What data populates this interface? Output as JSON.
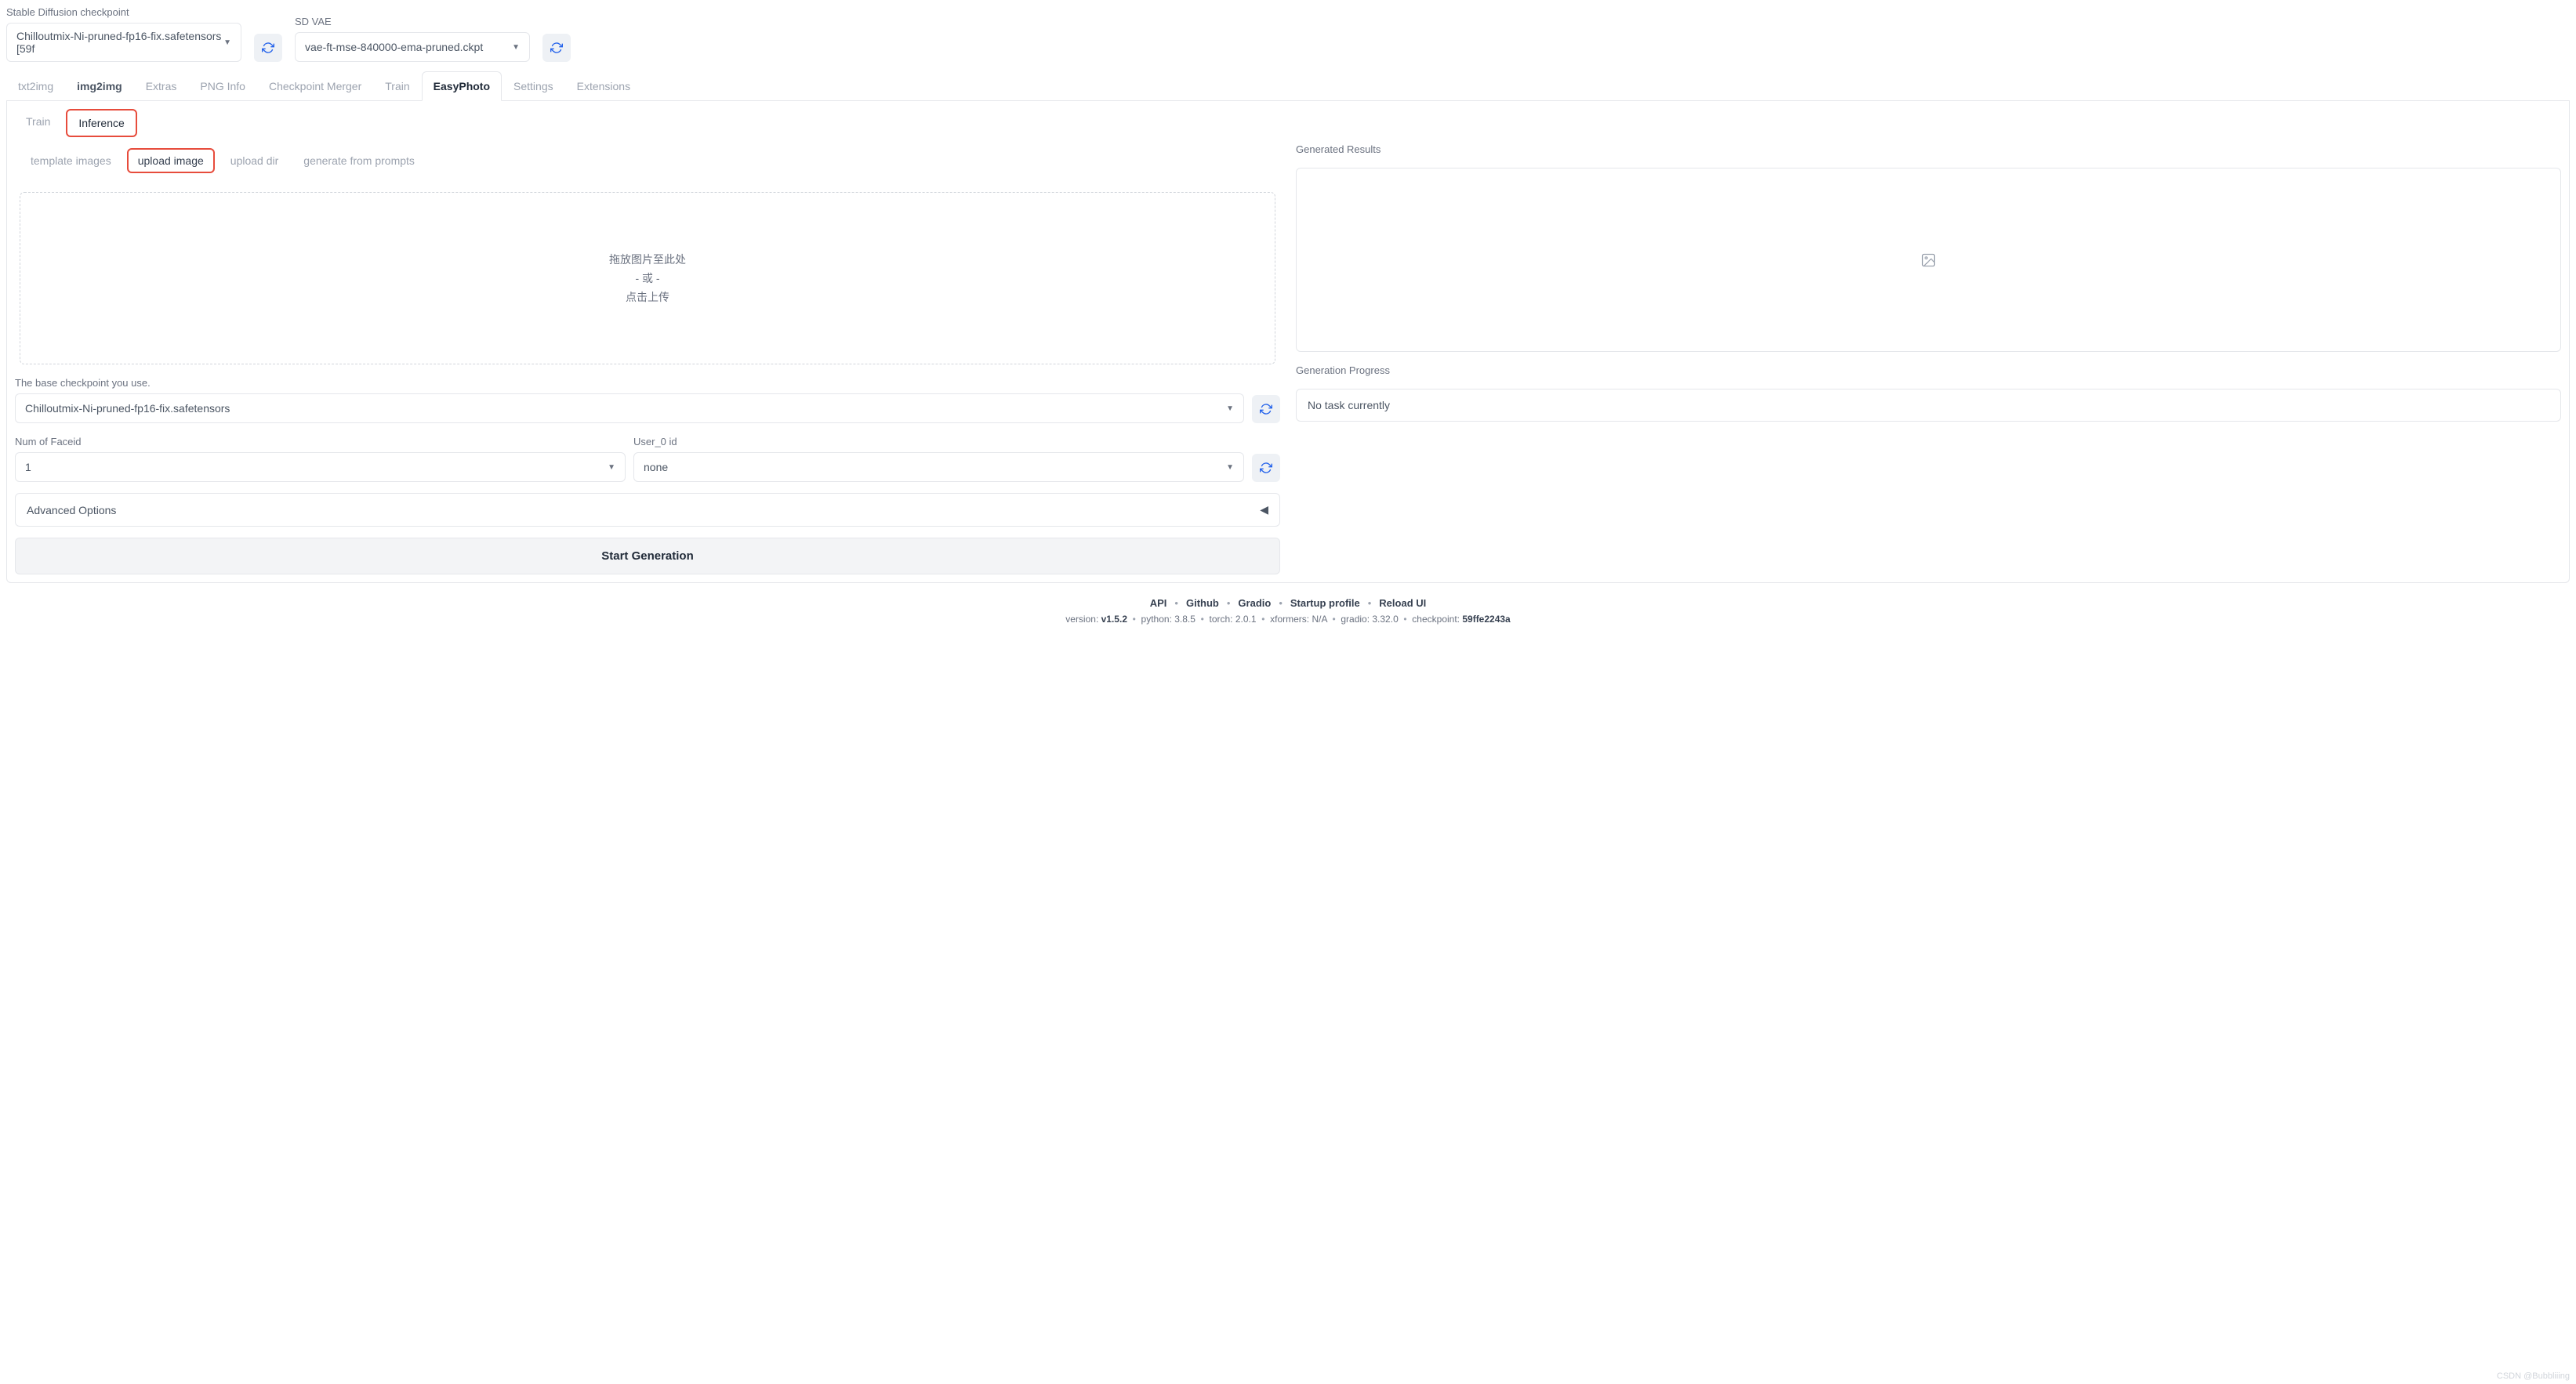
{
  "header": {
    "checkpoint_label": "Stable Diffusion checkpoint",
    "checkpoint_value": "Chilloutmix-Ni-pruned-fp16-fix.safetensors [59f",
    "vae_label": "SD VAE",
    "vae_value": "vae-ft-mse-840000-ema-pruned.ckpt"
  },
  "tabs": [
    "txt2img",
    "img2img",
    "Extras",
    "PNG Info",
    "Checkpoint Merger",
    "Train",
    "EasyPhoto",
    "Settings",
    "Extensions"
  ],
  "subtabs": [
    "Train",
    "Inference"
  ],
  "innertabs": [
    "template images",
    "upload image",
    "upload dir",
    "generate from prompts"
  ],
  "dropzone": {
    "line1": "拖放图片至此处",
    "line2": "- 或 -",
    "line3": "点击上传"
  },
  "base_checkpoint": {
    "label": "The base checkpoint you use.",
    "value": "Chilloutmix-Ni-pruned-fp16-fix.safetensors"
  },
  "faceid": {
    "label": "Num of Faceid",
    "value": "1"
  },
  "userid": {
    "label": "User_0 id",
    "value": "none"
  },
  "advanced_label": "Advanced Options",
  "start_btn": "Start Generation",
  "results": {
    "label": "Generated Results"
  },
  "progress": {
    "label": "Generation Progress",
    "value": "No task currently"
  },
  "footer": {
    "links": [
      "API",
      "Github",
      "Gradio",
      "Startup profile",
      "Reload UI"
    ],
    "version_label": "version: ",
    "version": "v1.5.2",
    "python_label": "python: ",
    "python": "3.8.5",
    "torch_label": "torch: ",
    "torch": "2.0.1",
    "xformers_label": "xformers: ",
    "xformers": "N/A",
    "gradio_label": "gradio: ",
    "gradio": "3.32.0",
    "checkpoint_label": "checkpoint: ",
    "checkpoint": "59ffe2243a"
  },
  "watermark": "CSDN @Bubbliiing"
}
